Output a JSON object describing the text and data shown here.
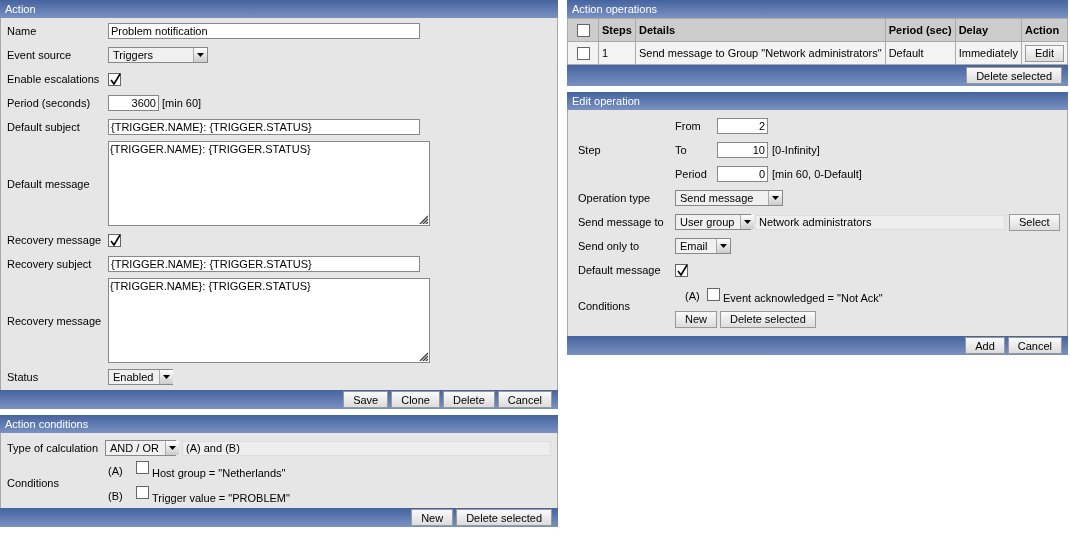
{
  "action": {
    "title": "Action",
    "fields": [
      {
        "kind": "text",
        "label": "Name",
        "value": "Problem notification"
      },
      {
        "kind": "select",
        "label": "Event source",
        "value": "Triggers"
      },
      {
        "kind": "checkbox",
        "label": "Enable escalations",
        "checked": true
      },
      {
        "kind": "number",
        "label": "Period (seconds)",
        "value": "3600",
        "hint": "[min 60]"
      },
      {
        "kind": "text",
        "label": "Default subject",
        "value": "{TRIGGER.NAME}: {TRIGGER.STATUS}"
      },
      {
        "kind": "textarea",
        "label": "Default message",
        "value": "{TRIGGER.NAME}: {TRIGGER.STATUS}"
      },
      {
        "kind": "checkbox",
        "label": "Recovery message",
        "checked": true
      },
      {
        "kind": "text",
        "label": "Recovery subject",
        "value": "{TRIGGER.NAME}: {TRIGGER.STATUS}"
      },
      {
        "kind": "textarea",
        "label": "Recovery message",
        "value": "{TRIGGER.NAME}: {TRIGGER.STATUS}"
      },
      {
        "kind": "select",
        "label": "Status",
        "value": "Enabled"
      }
    ],
    "buttons": [
      "Save",
      "Clone",
      "Delete",
      "Cancel"
    ]
  },
  "action_conditions": {
    "title": "Action conditions",
    "calculation": {
      "label": "Type of calculation",
      "value": "AND / OR",
      "formula": "(A) and (B)"
    },
    "conditions_label": "Conditions",
    "conditions": [
      {
        "tag": "(A)",
        "text": "Host group = \"Netherlands\"",
        "checked": false
      },
      {
        "tag": "(B)",
        "text": "Trigger value = \"PROBLEM\"",
        "checked": false
      }
    ],
    "buttons": [
      "New",
      "Delete selected"
    ]
  },
  "action_operations": {
    "title": "Action operations",
    "all_checked": false,
    "columns": [
      "Steps",
      "Details",
      "Period (sec)",
      "Delay",
      "Action"
    ],
    "rows": [
      {
        "checked": false,
        "steps": "1",
        "details": "Send message to Group \"Network administrators\"",
        "period": "Default",
        "delay": "Immediately",
        "action": "Edit"
      }
    ],
    "buttons": [
      "Delete selected"
    ]
  },
  "edit_operation": {
    "title": "Edit operation",
    "step": {
      "label": "Step",
      "items": [
        {
          "label": "From",
          "value": "2"
        },
        {
          "label": "To",
          "value": "10",
          "hint": "[0-Infinity]"
        },
        {
          "label": "Period",
          "value": "0",
          "hint": "[min 60, 0-Default]"
        }
      ]
    },
    "fields": [
      {
        "kind": "select",
        "label": "Operation type",
        "value": "Send message"
      },
      {
        "kind": "select_pick",
        "label": "Send message to",
        "value": "User group",
        "target": "Network administrators",
        "button": "Select"
      },
      {
        "kind": "select",
        "label": "Send only to",
        "value": "Email"
      },
      {
        "kind": "checkbox",
        "label": "Default message",
        "checked": true
      }
    ],
    "conditions": {
      "label": "Conditions",
      "items": [
        {
          "tag": "(A)",
          "text": "Event acknowledged = \"Not Ack\"",
          "checked": false
        }
      ],
      "buttons": [
        "New",
        "Delete selected"
      ]
    },
    "buttons": [
      "Add",
      "Cancel"
    ]
  }
}
